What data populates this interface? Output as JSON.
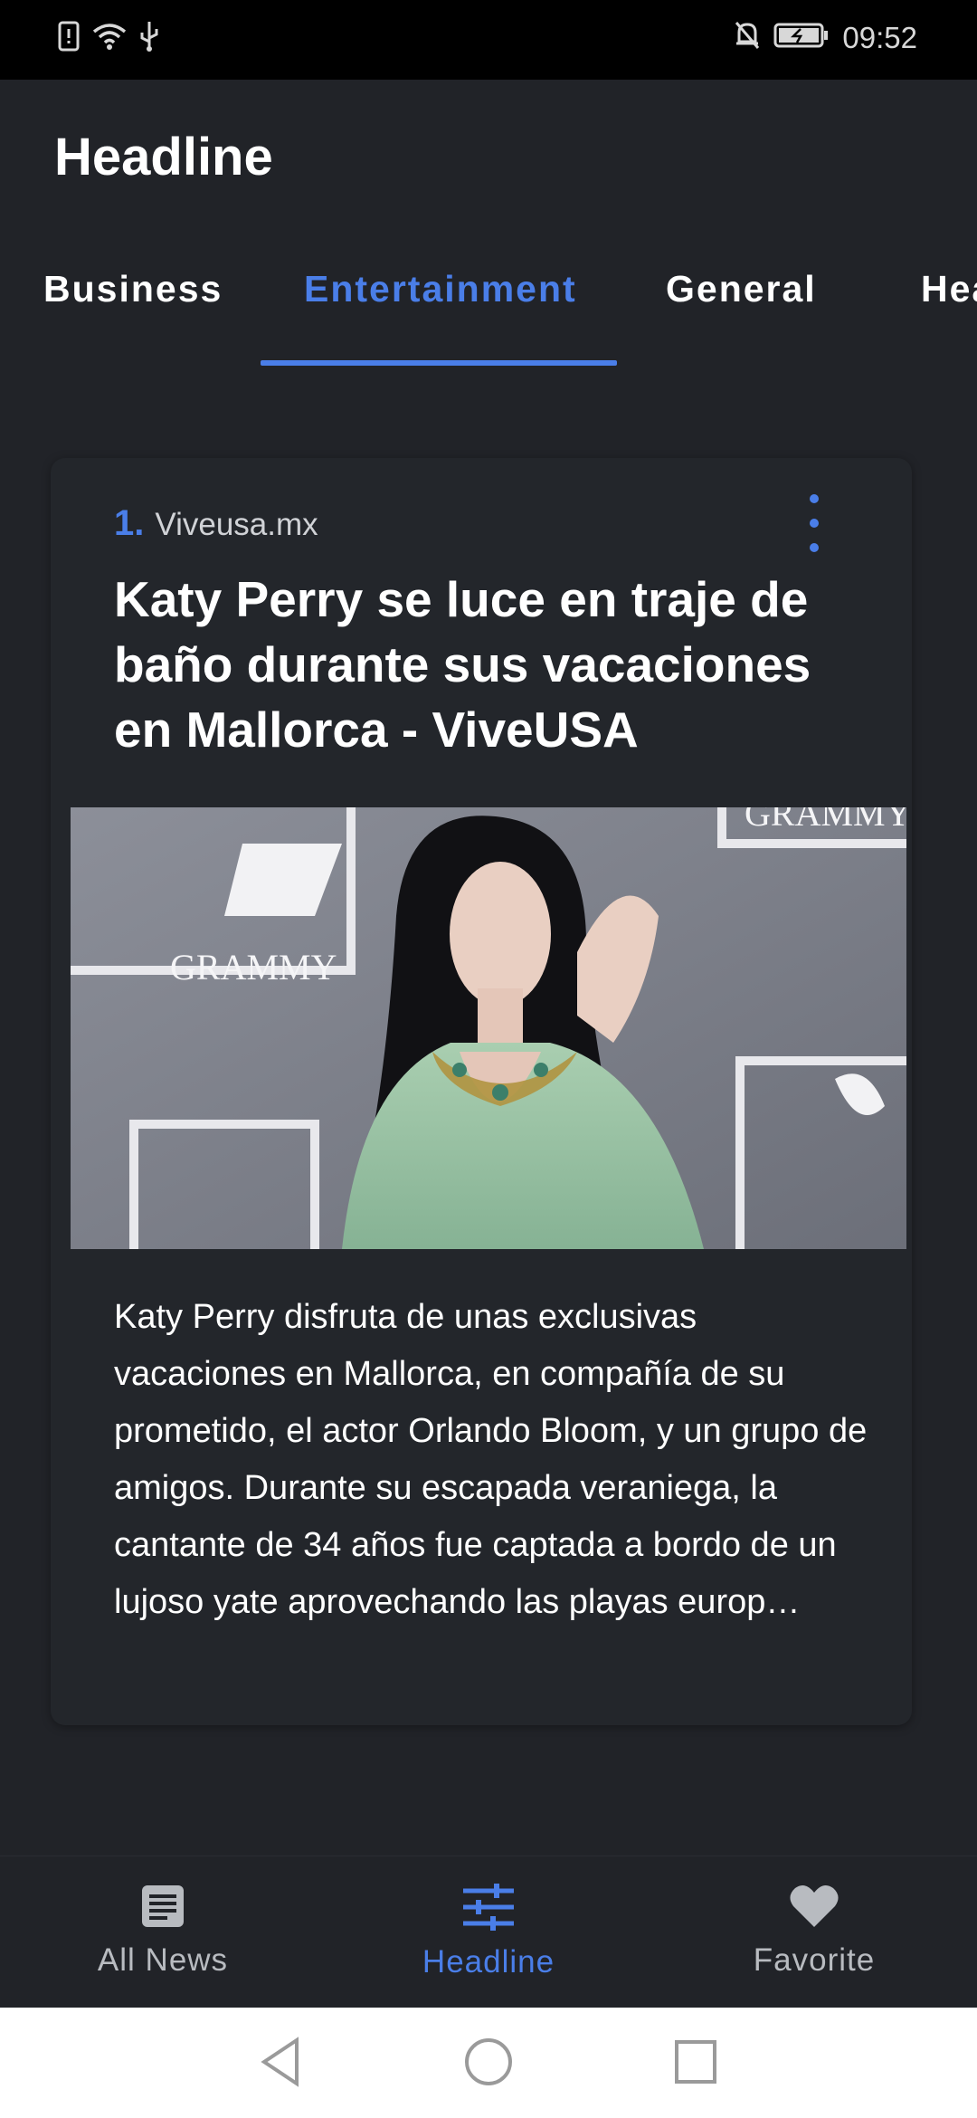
{
  "status_bar": {
    "time": "09:52",
    "left_icons": [
      "sim-alert-icon",
      "wifi-icon",
      "usb-icon"
    ],
    "right_icons": [
      "notifications-off-icon",
      "battery-charging-icon"
    ]
  },
  "app_bar": {
    "title": "Headline"
  },
  "tabs": [
    {
      "label": "Business",
      "active": false
    },
    {
      "label": "Entertainment",
      "active": true
    },
    {
      "label": "General",
      "active": false
    },
    {
      "label": "Hea",
      "active": false
    }
  ],
  "article": {
    "rank": "1.",
    "source": "Viveusa.mx",
    "title": "Katy Perry se luce en traje de baño durante sus vacaciones en Mallorca - ViveUSA",
    "image_caption_text": "GRAMMY",
    "description": "Katy Perry disfruta de unas exclusivas vacaciones en Mallorca, en compañía de su prometido, el actor Orlando Bloom, y un grupo de amigos. Durante su escapada veraniega, la cantante de 34 años fue captada a bordo de un lujoso yate aprovechando las playas europ…"
  },
  "bottom_nav": [
    {
      "label": "All News",
      "icon": "article-icon",
      "active": false
    },
    {
      "label": "Headline",
      "icon": "tune-icon",
      "active": true
    },
    {
      "label": "Favorite",
      "icon": "heart-icon",
      "active": false
    }
  ],
  "colors": {
    "background": "#212328",
    "card": "#23262b",
    "accent": "#4a7ee8",
    "text": "#ffffff"
  }
}
